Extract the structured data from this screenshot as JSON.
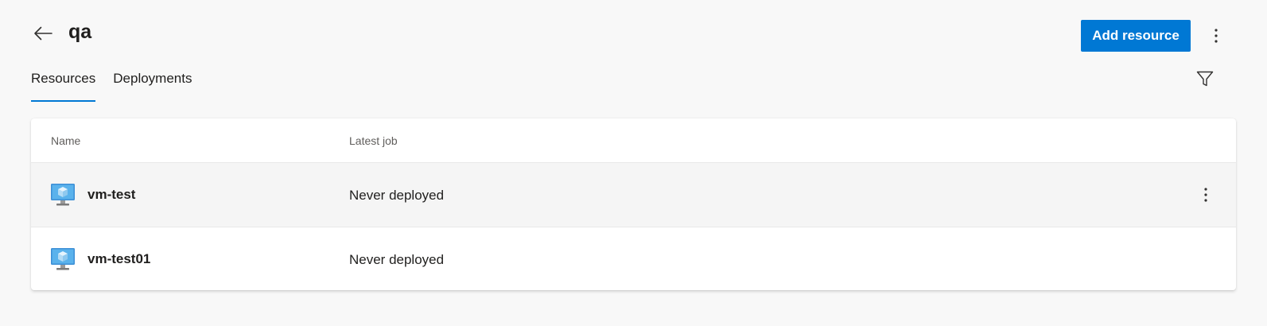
{
  "header": {
    "title": "qa",
    "add_button_label": "Add resource"
  },
  "tabs": [
    {
      "label": "Resources",
      "active": true
    },
    {
      "label": "Deployments",
      "active": false
    }
  ],
  "table": {
    "columns": {
      "name": "Name",
      "latest_job": "Latest job"
    },
    "rows": [
      {
        "name": "vm-test",
        "latest_job": "Never deployed",
        "icon": "virtual-machine-icon"
      },
      {
        "name": "vm-test01",
        "latest_job": "Never deployed",
        "icon": "virtual-machine-icon"
      }
    ]
  },
  "colors": {
    "accent": "#0078d4",
    "background": "#f8f8f8",
    "card": "#ffffff",
    "text": "#201f1e",
    "muted_text": "#605e5c"
  },
  "icons": {
    "back": "arrow-left-icon",
    "more": "more-vertical-icon",
    "filter": "filter-icon",
    "resource": "virtual-machine-icon"
  }
}
